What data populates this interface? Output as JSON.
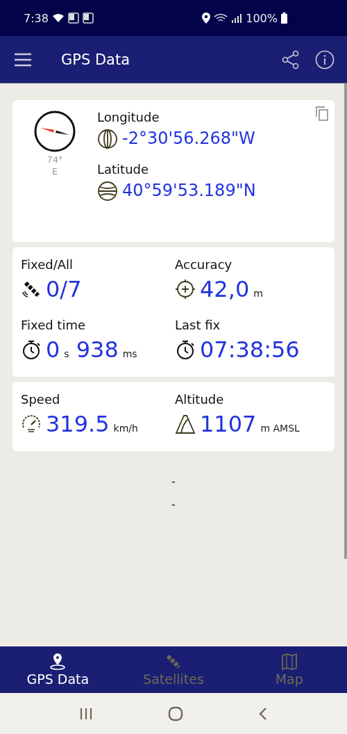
{
  "status_bar": {
    "time": "7:38",
    "battery": "100%"
  },
  "app_bar": {
    "title": "GPS Data"
  },
  "position": {
    "heading": "74°",
    "direction": "E",
    "coords": [
      {
        "label": "Longitude",
        "value": "-2°30'56.268\"W",
        "kind": "longitude"
      },
      {
        "label": "Latitude",
        "value": "40°59'53.189\"N",
        "kind": "latitude"
      }
    ]
  },
  "metric_cards": [
    {
      "metrics": [
        {
          "label": "Fixed/All",
          "kind": "satellite",
          "parts": [
            {
              "text": "0/7",
              "kind": "value"
            }
          ]
        },
        {
          "label": "Accuracy",
          "kind": "target",
          "parts": [
            {
              "text": "42,0",
              "kind": "value"
            },
            {
              "text": "m",
              "kind": "unit"
            }
          ]
        },
        {
          "label": "Fixed time",
          "kind": "timer",
          "parts": [
            {
              "text": "0",
              "kind": "value"
            },
            {
              "text": "s",
              "kind": "unit"
            },
            {
              "text": "938",
              "kind": "value"
            },
            {
              "text": "ms",
              "kind": "unit"
            }
          ]
        },
        {
          "label": "Last fix",
          "kind": "timer",
          "parts": [
            {
              "text": "07:38:56",
              "kind": "value"
            }
          ]
        }
      ]
    },
    {
      "metrics": [
        {
          "label": "Speed",
          "kind": "speedometer",
          "parts": [
            {
              "text": "319.5",
              "kind": "value"
            },
            {
              "text": "km/h",
              "kind": "unit"
            }
          ]
        },
        {
          "label": "Altitude",
          "kind": "mountain",
          "parts": [
            {
              "text": "1107",
              "kind": "value"
            },
            {
              "text": "m AMSL",
              "kind": "unit"
            }
          ]
        }
      ]
    }
  ],
  "placeholders": [
    "-",
    "-"
  ],
  "bottom_nav": [
    {
      "label": "GPS Data",
      "kind": "pin",
      "selected": true
    },
    {
      "label": "Satellites",
      "kind": "satellite",
      "selected": false
    },
    {
      "label": "Map",
      "kind": "map",
      "selected": false
    }
  ]
}
